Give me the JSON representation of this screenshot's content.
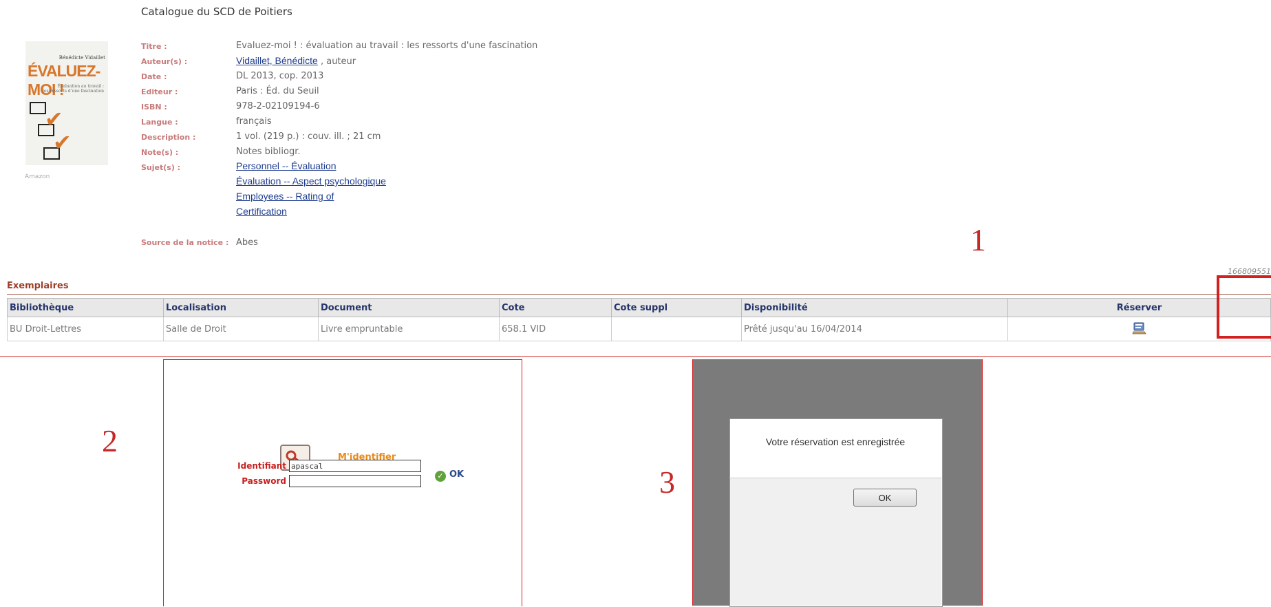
{
  "header": {
    "catalog_title": "Catalogue du SCD de Poitiers"
  },
  "cover": {
    "author": "Bénédicte Vidaillet",
    "title": "ÉVALUEZ-MOI !",
    "subtitle_line1": "Évaluation au travail :",
    "subtitle_line2": "les ressorts d'une fascination",
    "caption": "Amazon"
  },
  "record": {
    "titre_label": "Titre :",
    "titre_value": "Evaluez-moi ! : évaluation au travail : les ressorts d'une fascination",
    "auteur_label": "Auteur(s) :",
    "auteur_link": "Vidaillet, Bénédicte",
    "auteur_role": " , auteur",
    "date_label": "Date :",
    "date_value": "DL 2013, cop. 2013",
    "editeur_label": "Editeur :",
    "editeur_value": "Paris : Éd. du Seuil",
    "isbn_label": "ISBN :",
    "isbn_value": "978-2-02109194-6",
    "langue_label": "Langue :",
    "langue_value": "français",
    "description_label": "Description :",
    "description_value": "1 vol. (219 p.) : couv. ill. ; 21 cm",
    "notes_label": "Note(s) :",
    "notes_value": "Notes bibliogr.",
    "sujets_label": "Sujet(s) :",
    "sujets": [
      "Personnel -- Évaluation",
      "Évaluation -- Aspect psychologique",
      "Employees -- Rating of",
      "Certification"
    ],
    "source_label": "Source de la notice :",
    "source_value": "Abes",
    "record_id": "166809551"
  },
  "annotations": {
    "step1": "1",
    "step2": "2",
    "step3": "3"
  },
  "holdings": {
    "section_title": "Exemplaires",
    "columns": [
      "Bibliothèque",
      "Localisation",
      "Document",
      "Cote",
      "Cote suppl",
      "Disponibilité",
      "Réserver"
    ],
    "rows": [
      {
        "bibliotheque": "BU Droit-Lettres",
        "localisation": "Salle de Droit",
        "document": "Livre empruntable",
        "cote": "658.1 VID",
        "cote_suppl": "",
        "disponibilite": "Prêté jusqu'au 16/04/2014",
        "reserve_icon": "reserve-icon"
      }
    ]
  },
  "login": {
    "link_label": "M'identifier",
    "identifiant_label": "Identifiant",
    "identifiant_value": "apascal",
    "password_label": "Password",
    "password_value": "",
    "ok_label": "OK",
    "icon": "key-icon"
  },
  "confirmation": {
    "message": "Votre réservation est enregistrée",
    "ok_label": "OK"
  },
  "colors": {
    "label_red": "#c87a7a",
    "link_blue": "#1e3d8f",
    "annotation_red": "#d32020",
    "section_brown": "#9c3f2a",
    "login_orange": "#e88a1a"
  }
}
